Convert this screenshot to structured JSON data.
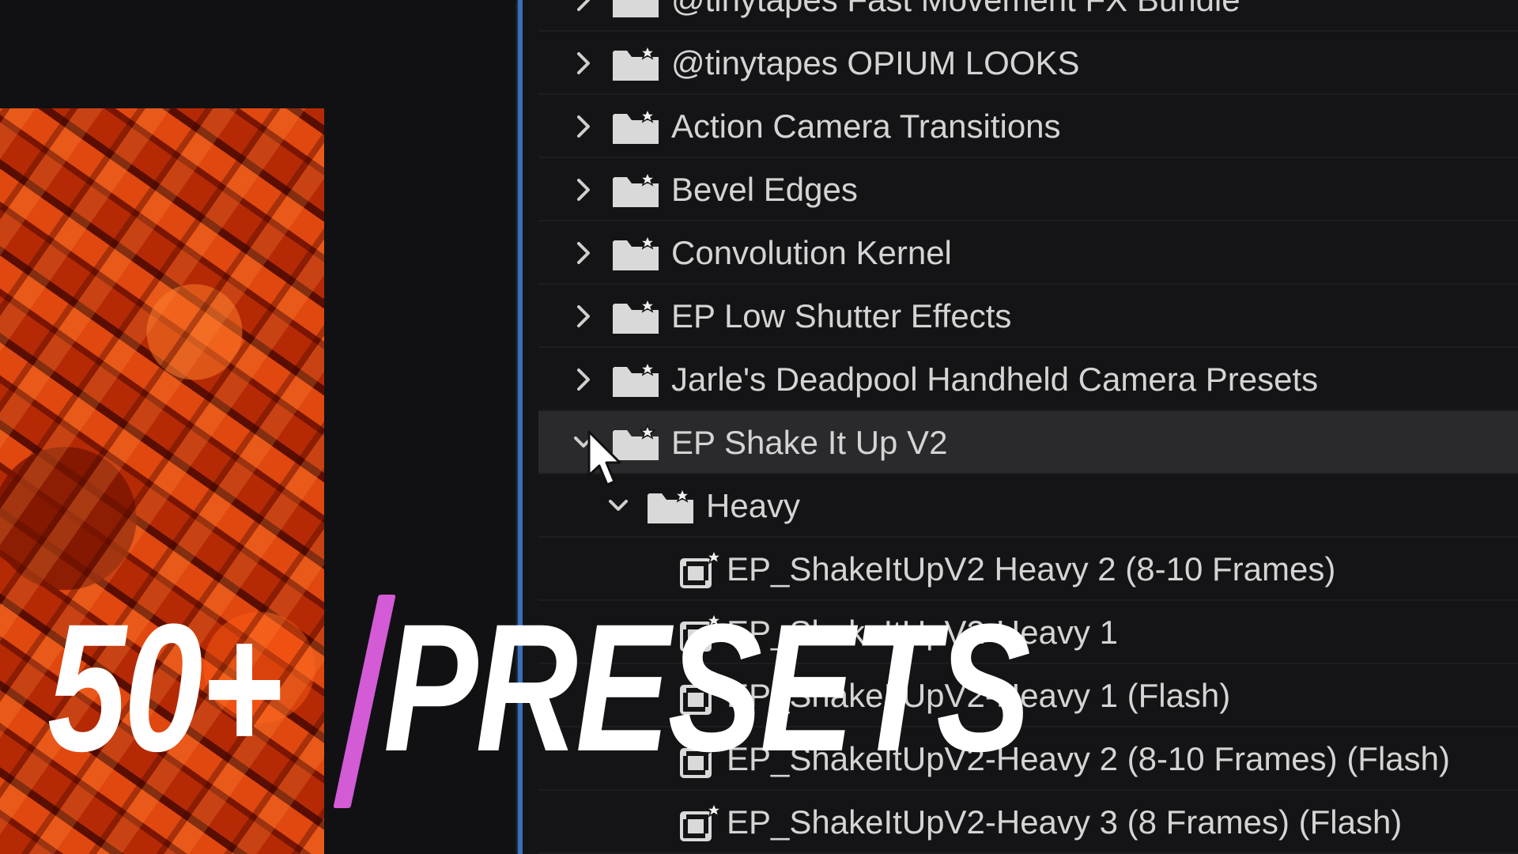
{
  "overlay": {
    "count": "50+",
    "word": "PRESETS",
    "bar_color": "#d35bd6"
  },
  "effects_tree": {
    "rows": [
      {
        "label": "@tinytapes Fast Movement FX Bundle",
        "type": "bin",
        "expanded": false,
        "partial": true
      },
      {
        "label": "@tinytapes OPIUM LOOKS",
        "type": "bin",
        "expanded": false
      },
      {
        "label": "Action Camera Transitions",
        "type": "bin",
        "expanded": false
      },
      {
        "label": "Bevel Edges",
        "type": "bin",
        "expanded": false
      },
      {
        "label": "Convolution Kernel",
        "type": "bin",
        "expanded": false
      },
      {
        "label": "EP Low Shutter Effects",
        "type": "bin",
        "expanded": false
      },
      {
        "label": "Jarle's Deadpool Handheld Camera Presets",
        "type": "bin",
        "expanded": false
      },
      {
        "label": "EP Shake It Up V2",
        "type": "bin",
        "expanded": true,
        "selected": true
      },
      {
        "label": "Heavy",
        "type": "bin",
        "expanded": true,
        "level": 1
      },
      {
        "label": "EP_ShakeItUpV2 Heavy 2 (8-10 Frames)",
        "type": "preset",
        "level": 2
      },
      {
        "label": "EP_ShakeItUpV2-Heavy 1",
        "type": "preset",
        "level": 2
      },
      {
        "label": "EP_ShakeItUpV2-Heavy 1 (Flash)",
        "type": "preset",
        "level": 2
      },
      {
        "label": "EP_ShakeItUpV2-Heavy 2 (8-10 Frames) (Flash)",
        "type": "preset",
        "level": 2
      },
      {
        "label": "EP_ShakeItUpV2-Heavy 3 (8 Frames) (Flash)",
        "type": "preset",
        "level": 2
      }
    ]
  },
  "icons": {
    "bin": "preset-bin-folder-icon",
    "preset": "preset-item-icon",
    "collapsed": "chevron-right-icon",
    "expanded": "chevron-down-icon",
    "cursor": "mouse-pointer-icon"
  },
  "colors": {
    "divider": "#3a6fb8",
    "text": "#d4d4d4",
    "selected_row": "#2a2a2d"
  }
}
